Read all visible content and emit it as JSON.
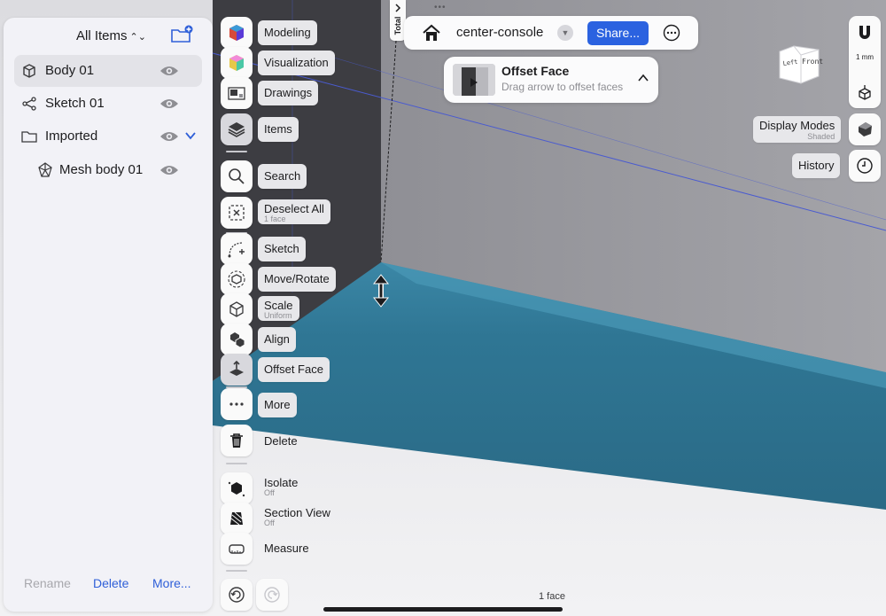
{
  "items_panel": {
    "title": "All Items",
    "tree": [
      {
        "label": "Body 01",
        "icon": "body-cube-icon",
        "selected": true,
        "visible": true
      },
      {
        "label": "Sketch 01",
        "icon": "sketch-nodes-icon",
        "selected": false,
        "visible": true
      },
      {
        "label": "Imported",
        "icon": "folder-icon",
        "selected": false,
        "visible": true,
        "expanded": true
      },
      {
        "label": "Mesh body 01",
        "icon": "mesh-icon",
        "selected": false,
        "visible": true
      }
    ],
    "footer": {
      "rename": "Rename",
      "delete": "Delete",
      "more": "More..."
    }
  },
  "toolbar": {
    "modeling": "Modeling",
    "visualization": "Visualization",
    "drawings": "Drawings",
    "items": "Items",
    "search": "Search",
    "deselect_all": "Deselect All",
    "deselect_sub": "1 face",
    "sketch": "Sketch",
    "move_rotate": "Move/Rotate",
    "scale": "Scale",
    "scale_sub": "Uniform",
    "align": "Align",
    "offset_face": "Offset Face",
    "more": "More",
    "delete": "Delete",
    "isolate": "Isolate",
    "isolate_sub": "Off",
    "section_view": "Section View",
    "section_sub": "Off",
    "measure": "Measure"
  },
  "doc_bar": {
    "title": "center-console",
    "share": "Share..."
  },
  "operation": {
    "title": "Offset Face",
    "hint": "Drag arrow to offset faces"
  },
  "total_tab": "Total",
  "right_panel": {
    "snap_value": "1 mm",
    "display_modes": "Display Modes",
    "display_sub": "Shaded",
    "history": "History",
    "cube_left": "Left",
    "cube_front": "Front"
  },
  "status": "1 face",
  "colors": {
    "accent": "#2b62e0",
    "selected_face": "#2f7694",
    "body": "#9a9aa0"
  }
}
